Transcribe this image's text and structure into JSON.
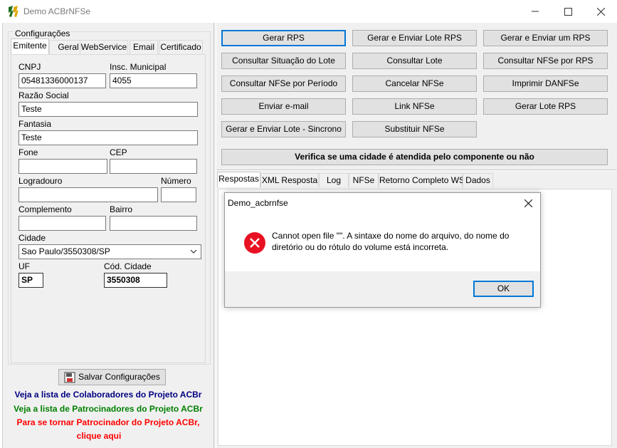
{
  "window": {
    "title": "Demo ACBrNFSe"
  },
  "config": {
    "group_title": "Configurações",
    "tabs": [
      "Emitente",
      "Geral",
      "WebService",
      "Email",
      "Certificado"
    ],
    "fields": {
      "cnpj_label": "CNPJ",
      "cnpj_value": "05481336000137",
      "insc_label": "Insc. Municipal",
      "insc_value": "4055",
      "razao_label": "Razão Social",
      "razao_value": "Teste",
      "fantasia_label": "Fantasia",
      "fantasia_value": "Teste",
      "fone_label": "Fone",
      "fone_value": "",
      "cep_label": "CEP",
      "cep_value": "",
      "logradouro_label": "Logradouro",
      "logradouro_value": "",
      "numero_label": "Número",
      "numero_value": "",
      "complemento_label": "Complemento",
      "complemento_value": "",
      "bairro_label": "Bairro",
      "bairro_value": "",
      "cidade_label": "Cidade",
      "cidade_value": "Sao Paulo/3550308/SP",
      "uf_label": "UF",
      "uf_value": "SP",
      "cod_cidade_label": "Cód. Cidade",
      "cod_cidade_value": "3550308"
    },
    "save_button": "Salvar Configurações"
  },
  "links": {
    "colaboradores": "Veja a lista de Colaboradores do Projeto ACBr",
    "patrocinadores": "Veja a lista de Patrocinadores do Projeto ACBr",
    "tornar_line1": "Para se tornar Patrocinador do Projeto ACBr,",
    "tornar_line2": "clique aqui",
    "colors": {
      "colaboradores": "#000080",
      "patrocinadores": "#008000",
      "tornar": "#ff0000"
    }
  },
  "actions": {
    "buttons": [
      "Gerar RPS",
      "Gerar e Enviar Lote RPS",
      "Gerar e Enviar um RPS",
      "Consultar Situação do Lote",
      "Consultar Lote",
      "Consultar NFSe por RPS",
      "Consultar NFSe por Período",
      "Cancelar NFSe",
      "Imprimir DANFSe",
      "Enviar e-mail",
      "Link NFSe",
      "Gerar Lote RPS",
      "Gerar e Enviar Lote - Sincrono",
      "Substituir NFSe"
    ],
    "verify_button": "Verifica se uma cidade é atendida pelo componente ou não"
  },
  "result_tabs": [
    "Respostas",
    "XML Resposta",
    "Log",
    "NFSe",
    "Retorno Completo WS",
    "Dados"
  ],
  "dialog": {
    "title": "Demo_acbrnfse",
    "message_line1": "Cannot open file \"\". A sintaxe do nome do arquivo, do nome do",
    "message_line2": "diretório ou do rótulo do volume está incorreta.",
    "ok_button": "OK",
    "error_color": "#e81123"
  }
}
